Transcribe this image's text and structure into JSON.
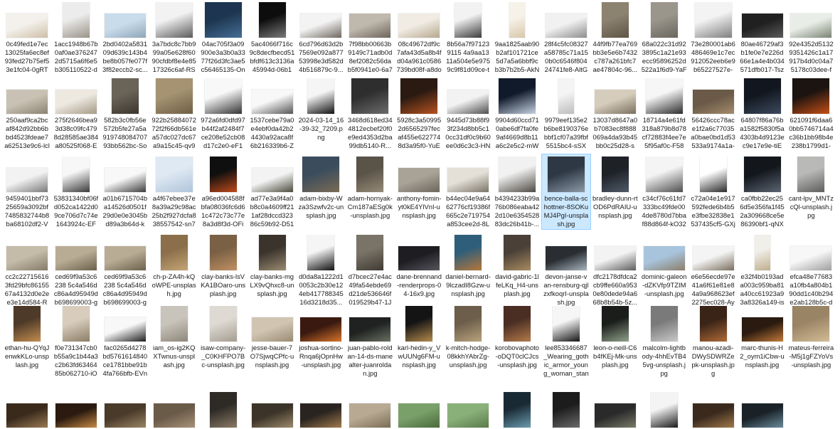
{
  "view": {
    "title": "",
    "columns": 17
  },
  "files": [
    {
      "name": "0c49fed1e7ec13025fa6ec8ef93fed27b75ef53e1fc04-0gRTB...",
      "thumb": {
        "bg": "#f4f1ec",
        "fg": "#cdbfa8",
        "shape": "landscape"
      }
    },
    {
      "name": "1acc1948b67b0af0ae3762472d5715a6f6e5b305110522-dMB...",
      "thumb": {
        "bg": "#ececec",
        "fg": "#9a9389",
        "shape": "portrait"
      }
    },
    {
      "name": "2bd0402a583109d639c143b4be8b057fe077f3f82eccb2-sc...",
      "thumb": {
        "bg": "#c9dcec",
        "fg": "#8fa6b8",
        "shape": "landscape"
      }
    },
    {
      "name": "3a7bdc8c7bb999a05e628f6090cfdbf8e4e8517326c6af-RSf...",
      "thumb": {
        "bg": "#f2f2f2",
        "fg": "#5b5b5b",
        "shape": "square"
      }
    },
    {
      "name": "04ac705f3a09900e3a3b0a3377f26d3fc3ae5c56465135-OnoT...",
      "thumb": {
        "bg": "#1d3550",
        "fg": "#456f96",
        "shape": "square"
      }
    },
    {
      "name": "5ac4066f716c9c8decfbecd51bfdf613c3136a45994d-06b1b...",
      "thumb": {
        "bg": "#0d0d0d",
        "fg": "#7a7a7a",
        "shape": "portrait"
      }
    },
    {
      "name": "6cd796d63d2b7569e092a87753998e3d582d4b516879c-9...",
      "thumb": {
        "bg": "#f3f3f3",
        "fg": "#6e675d",
        "shape": "landscape"
      }
    },
    {
      "name": "7f98bb00663b9149c71adb0d8ef2082c56dab5f0941e0-6a76...",
      "thumb": {
        "bg": "#bfb8ad",
        "fg": "#6d655b",
        "shape": "landscape"
      }
    },
    {
      "name": "08c49672df9c7afa43d5a8b4fd04a961c0586739bd08f-a8do1...",
      "thumb": {
        "bg": "#f0ece4",
        "fg": "#b7a88f",
        "shape": "landscape"
      }
    },
    {
      "name": "8b56a7f971239115 4a9aa1311a504e5e9759c9f81d09ce-taYP...",
      "thumb": {
        "bg": "#f2f2f2",
        "fg": "#3b3b3b",
        "shape": "portrait"
      }
    },
    {
      "name": "9aa1825aab90b2af101721ce5d7a5a6bbf9cb3b7b2b5-AkNr...",
      "thumb": {
        "bg": "#f6f2ea",
        "fg": "#d9c8aa",
        "shape": "tall"
      }
    },
    {
      "name": "28f4c5fc08327a58785c71a150b0c6546f80424741fe8-AltGo...",
      "thumb": {
        "bg": "#f1f1f1",
        "fg": "#8d8d8d",
        "shape": "landscape"
      }
    },
    {
      "name": "44f9fb77ea769bb3e5e6b7432c787a261bfc7ae47804c-96...",
      "thumb": {
        "bg": "#8c8270",
        "fg": "#5d5547",
        "shape": "portrait"
      }
    },
    {
      "name": "68a022c31d923895c1a21e93ecc95896252d522a1f6d9-YaF9...",
      "thumb": {
        "bg": "#9b968c",
        "fg": "#6a665e",
        "shape": "portrait"
      }
    },
    {
      "name": "73e280001ab6486469e1c7ec912052eeb6e9b65227527e-Q...",
      "thumb": {
        "bg": "#f3f3f3",
        "fg": "#7f7f7f",
        "shape": "square"
      }
    },
    {
      "name": "80ae46729af3b1fe0e7e226d66e1a4e4b034571dfb017-Tszy...",
      "thumb": {
        "bg": "#202020",
        "fg": "#5a5a5a",
        "shape": "landscape"
      }
    },
    {
      "name": "92e4352d51329351426c1a17917b4d0c04a75178c03dee-f6...",
      "thumb": {
        "bg": "#e9ede7",
        "fg": "#7b8474",
        "shape": "landscape"
      }
    },
    {
      "name": "250aaf9ca2bcaf842d92bb6bbd4523fdeae7a62513e9c6-lclzfj...",
      "thumb": {
        "bg": "#c9c2b4",
        "fg": "#8b8272",
        "shape": "landscape"
      }
    },
    {
      "name": "275f2646bea93d38c09fc4798d28585ae384a80525f068-Egw...",
      "thumb": {
        "bg": "#ede9e1",
        "fg": "#a69a86",
        "shape": "landscape"
      }
    },
    {
      "name": "582b3c0fb56e572b5fe27a5a91974808470793bb562bc-Soa...",
      "thumb": {
        "bg": "#6a6358",
        "fg": "#3c372f",
        "shape": "portrait"
      }
    },
    {
      "name": "922b25884072 72f2f66db561ea57dc027dc67a9a15c45-qv95...",
      "thumb": {
        "bg": "#a59372",
        "fg": "#6e5f45",
        "shape": "square"
      }
    },
    {
      "name": "972a6fd0dfd97b44f2af2484f7ce208e52cb08d17c2e0-eF1B...",
      "thumb": {
        "bg": "#f8f8f8",
        "fg": "#333333",
        "shape": "square"
      }
    },
    {
      "name": "1537cebe79a0e4ebf0da42b24430a92aca8f6b216339b6-Znh...",
      "thumb": {
        "bg": "#f8f8f8",
        "fg": "#555555",
        "shape": "landscape"
      }
    },
    {
      "name": "2024-03-14_16-39-32_7209.png",
      "thumb": {
        "bg": "#f5f5f5",
        "fg": "#111111",
        "shape": "portrait"
      }
    },
    {
      "name": "3468d618ed344812ecbef20f0e9ed4353d2ba99db5140-R...",
      "thumb": {
        "bg": "#2e2e2e",
        "fg": "#6b6b6b",
        "shape": "square"
      }
    },
    {
      "name": "5928c3a509952d6565297fecaf455e6227748d3a95f0-YuEw...",
      "thumb": {
        "bg": "#2a1a12",
        "fg": "#b6521f",
        "shape": "square"
      }
    },
    {
      "name": "9445d73b88f93f234d8bb5c10cc31df0c9b60ee0d6c3c3-HNx...",
      "thumb": {
        "bg": "#f2f2f2",
        "fg": "#4e4e4e",
        "shape": "landscape"
      }
    },
    {
      "name": "9904d60ccd710abe6df7fa0fe9af4669d8b11a6c2e5c2-mW8...",
      "thumb": {
        "bg": "#101a2a",
        "fg": "#c6d2e2",
        "shape": "square"
      }
    },
    {
      "name": "9979eef135e2b6be8190376ebbf1cf07a39fbf5515bc4-sSXH...",
      "thumb": {
        "bg": "#f4f4f4",
        "fg": "#bdbdbd",
        "shape": "tall"
      }
    },
    {
      "name": "13037d8647a0b7083ec8f888069a4da93b45bb0c25d28-s2...",
      "thumb": {
        "bg": "#d6ccbb",
        "fg": "#7b7060",
        "shape": "landscape"
      }
    },
    {
      "name": "18714a4e61fd318a879b8d78cf72883f4ee7e5f95af0c-F58m...",
      "thumb": {
        "bg": "#f6f6f6",
        "fg": "#2c2c2c",
        "shape": "square"
      }
    },
    {
      "name": "56426ccc78ace1f2a6c77035a0bae0bd1d53533a9174a1a-nL...",
      "thumb": {
        "bg": "#6a5a47",
        "fg": "#a48b6b",
        "shape": "landscape"
      }
    },
    {
      "name": "64807f86a76ba1582f5830f5a4303b4d9123ec9e17e9e-tiEo...",
      "thumb": {
        "bg": "#12171f",
        "fg": "#3c4a5e",
        "shape": "square"
      }
    },
    {
      "name": "621091f6daa60bb5746714a4c36b1bb98b4e238b1799d1-D...",
      "thumb": {
        "bg": "#1c1410",
        "fg": "#c44e16",
        "shape": "square"
      }
    },
    {
      "name": "9459401bbf7325659a3092bf7485832744b8ba68102df2-VPz...",
      "thumb": {
        "bg": "#f2f2f2",
        "fg": "#7a7a7a",
        "shape": "landscape"
      }
    },
    {
      "name": "53831340bf06fd052ca1422d09ce706d7c74e1643924c-EF1...",
      "thumb": {
        "bg": "#f7f7f7",
        "fg": "#3a3a3a",
        "shape": "portrait"
      }
    },
    {
      "name": "a01b6715704ba14526d0501f29d0e0e3045bd89a3b64d-kH...",
      "thumb": {
        "bg": "#f8f8f8",
        "fg": "#3d3d3d",
        "shape": "landscape"
      }
    },
    {
      "name": "a4f67ebee37e8a39a29c98ac25b2f927dcfa838557542-sn74...",
      "thumb": {
        "bg": "#dfe9f3",
        "fg": "#b0c4da",
        "shape": "square"
      }
    },
    {
      "name": "a96ed004588fbfa08036fc6d61c472c73c77e8a3d8f3d-OFimL...",
      "thumb": {
        "bg": "#0f0f0f",
        "fg": "#c04a1a",
        "shape": "portrait"
      }
    },
    {
      "name": "ad77e3a9f4a0b8c0a4609ff211af28dccd32386c59b92-D51Bn...",
      "thumb": {
        "bg": "#f3f3f3",
        "fg": "#4b4b3e",
        "shape": "landscape"
      }
    },
    {
      "name": "adam-bixby-Wza3Szwfv2c-unsplash.jpg",
      "thumb": {
        "bg": "#3b4d5d",
        "fg": "#7a6a55",
        "shape": "square"
      }
    },
    {
      "name": "adam-hornyak-Cm187aESg0k-unsplash.jpg",
      "thumb": {
        "bg": "#5a5348",
        "fg": "#958a77",
        "shape": "portrait"
      }
    },
    {
      "name": "anthony-fomin-yt0kE4YlVnI-unsplash.jpg",
      "thumb": {
        "bg": "#a9a297",
        "fg": "#6c665c",
        "shape": "landscape"
      }
    },
    {
      "name": "b44ec04e9a6462776cf19386f665c2e719754a853cee2d-8Ler...",
      "thumb": {
        "bg": "#e4e0d8",
        "fg": "#7b7568",
        "shape": "landscape"
      }
    },
    {
      "name": "b4394233b99a76b086eaba422d10e6354528 83dc26b41b-...",
      "thumb": {
        "bg": "#f1f1f1",
        "fg": "#4f4b45",
        "shape": "square"
      }
    },
    {
      "name": "bence-balla-schottner-8SOKuMJ4PgI-unsplash.jpg",
      "thumb": {
        "bg": "#2e3845",
        "fg": "#8d99a8",
        "shape": "square"
      }
    },
    {
      "name": "bradley-dunn-rtOD6PdRAIU-unsplash.jpg",
      "thumb": {
        "bg": "#1e2126",
        "fg": "#4e5a68",
        "shape": "portrait"
      }
    },
    {
      "name": "c34cf76c61fd7333bc49fde004de8780d7bbaf88d864f-kO32nS...",
      "thumb": {
        "bg": "#f4f4f4",
        "fg": "#4f4f4f",
        "shape": "square"
      }
    },
    {
      "name": "c72a04e1e917592fede6b4b5e3fbe32838e1537435cf5-GXjKx...",
      "thumb": {
        "bg": "#ffffff",
        "fg": "#2b2b2b",
        "shape": "portrait"
      }
    },
    {
      "name": "ca0fbb22ec256d5e356fa1f452a309668ce5e86390bf1-qNXL...",
      "thumb": {
        "bg": "#13171c",
        "fg": "#5a6472",
        "shape": "square"
      }
    },
    {
      "name": "cant-lpv_MNTzcQl-unsplash.jpg",
      "thumb": {
        "bg": "#b9b9b7",
        "fg": "#5e5e5c",
        "shape": "portrait"
      }
    },
    {
      "name": "cc2c227156163fd29bfc8615567a4132d0e2ee3e14d584-Rc...",
      "thumb": {
        "bg": "#c4bba9",
        "fg": "#857b68",
        "shape": "landscape"
      }
    },
    {
      "name": "ced69f9a53c6238 5c4a546dc86a4d95949db698699003-gZ6...",
      "thumb": {
        "bg": "#b9ac95",
        "fg": "#6d604c",
        "shape": "landscape"
      }
    },
    {
      "name": "ced69f9a53c6238 5c4a546dc86a4d95949db698699003-gZ6...",
      "thumb": {
        "bg": "#b9ac95",
        "fg": "#6d604c",
        "shape": "landscape"
      }
    },
    {
      "name": "ch-p-ZA4h-kQoWPE-unsplash.jpg",
      "thumb": {
        "bg": "#8a6f4a",
        "fg": "#c4a574",
        "shape": "portrait"
      }
    },
    {
      "name": "clay-banks-lsVKA1BOaro-unsplash.jpg",
      "thumb": {
        "bg": "#7a6045",
        "fg": "#c09062",
        "shape": "portrait"
      }
    },
    {
      "name": "clay-banks-mgLX9vQhxc8-unsplash.jpg",
      "thumb": {
        "bg": "#3a342c",
        "fg": "#9a8a70",
        "shape": "portrait"
      }
    },
    {
      "name": "d0da8a1222d10053c2b30e12 4eb417788345 16d3218d35...",
      "thumb": {
        "bg": "#f5f5f5",
        "fg": "#111111",
        "shape": "portrait"
      }
    },
    {
      "name": "d7bcec27e4ac49fa54ebde69d21de536646f019529b47-1Jg9...",
      "thumb": {
        "bg": "#7a7468",
        "fg": "#3f3b34",
        "shape": "portrait"
      }
    },
    {
      "name": "dane-brennand-renderprops-04-16x9.jpg",
      "thumb": {
        "bg": "#1e1e22",
        "fg": "#55555d",
        "shape": "landscape"
      }
    },
    {
      "name": "daniel-bernard-9lczadI8Gzw-unsplash.jpg",
      "thumb": {
        "bg": "#2f5e7a",
        "fg": "#b5763a",
        "shape": "portrait"
      }
    },
    {
      "name": "david-gabric-1lfeLKq_H4-unsplash.jpg",
      "thumb": {
        "bg": "#4a4038",
        "fg": "#a88b5e",
        "shape": "portrait"
      }
    },
    {
      "name": "devon-janse-van-rensburg-qjlzxfkoqrI-unsplash.jpg",
      "thumb": {
        "bg": "#2a2e33",
        "fg": "#a7b3bd",
        "shape": "landscape"
      }
    },
    {
      "name": "dfc2178dfdca2cb9ffe660a9530e80dede94a668b8b54b-5z...",
      "thumb": {
        "bg": "#f3f3f3",
        "fg": "#5d5d5d",
        "shape": "landscape"
      }
    },
    {
      "name": "dominic-galeon-dZKVfp9TZIM-unsplash.jpg",
      "thumb": {
        "bg": "#a8c4dc",
        "fg": "#8b7e6a",
        "shape": "landscape"
      }
    },
    {
      "name": "e6e56ecde97e41a6f61e81e84a9a968623ef2275ec028-AyG...",
      "thumb": {
        "bg": "#f4f4f4",
        "fg": "#7a6e5d",
        "shape": "landscape"
      }
    },
    {
      "name": "e32f4b0193ada003c959ba81a40cc61923a93a8326a149-ishp...",
      "thumb": {
        "bg": "#f1efe9",
        "fg": "#bfae8c",
        "shape": "tall"
      }
    },
    {
      "name": "efca48e77683a10fb4a804b190dd1c40b294e2ab128b5c-dX...",
      "thumb": {
        "bg": "#f7f7f7",
        "fg": "#9f9f9f",
        "shape": "landscape"
      }
    },
    {
      "name": "ethan-hu-QYqJenwkKLo-unsplash.jpg",
      "thumb": {
        "bg": "#4e3a28",
        "fg": "#c28c4f",
        "shape": "portrait"
      }
    },
    {
      "name": "f0e731347cb0b55a9c1b44a3c2b63fd6346485b062710-iOGI1...",
      "thumb": {
        "bg": "#d8cdbd",
        "fg": "#8c7e66",
        "shape": "portrait"
      }
    },
    {
      "name": "fac0265d4278bd5761614840ce1781bbe91b4fa766bfb-EVnl...",
      "thumb": {
        "bg": "#f8f8f8",
        "fg": "#1f1f1f",
        "shape": "landscape"
      }
    },
    {
      "name": "iam_os-ig2KQXTwnus-unsplash.jpg",
      "thumb": {
        "bg": "#c9c4bb",
        "fg": "#8e877b",
        "shape": "portrait"
      }
    },
    {
      "name": "isaw-company-_C0KHFPO7Bc-unsplash.jpg",
      "thumb": {
        "bg": "#dedad3",
        "fg": "#a49d90",
        "shape": "portrait"
      }
    },
    {
      "name": "jesse-bauer-7O7SjwqCPfc-unsplash.jpg",
      "thumb": {
        "bg": "#d1c5b2",
        "fg": "#9a8b73",
        "shape": "landscape"
      }
    },
    {
      "name": "joshua-sortino-Rnqa6jOpnHw-unsplash.jpg",
      "thumb": {
        "bg": "#3a1a10",
        "fg": "#d8742a",
        "shape": "landscape"
      }
    },
    {
      "name": "juan-pablo-roldan-14-ds-manealter-juanroldan.jpg",
      "thumb": {
        "bg": "#1f2220",
        "fg": "#6a7063",
        "shape": "landscape"
      }
    },
    {
      "name": "karl-hedin-y_VwUUNg6FM-unsplash.jpg",
      "thumb": {
        "bg": "#141414",
        "fg": "#b38a4c",
        "shape": "portrait"
      }
    },
    {
      "name": "k-mitch-hodge-08kkhYAbrZg-unsplash.jpg",
      "thumb": {
        "bg": "#6c5e4a",
        "fg": "#b9a27c",
        "shape": "portrait"
      }
    },
    {
      "name": "korobovaphoto-oDQT0clCJcs-unsplash.jpg",
      "thumb": {
        "bg": "#4a2e24",
        "fg": "#b47a4a",
        "shape": "portrait"
      }
    },
    {
      "name": "lee853346687_Wearing_gothic_armor_young_woman_standi...",
      "thumb": {
        "bg": "#f6f6f6",
        "fg": "#151515",
        "shape": "portrait"
      }
    },
    {
      "name": "leon-o-neill-C6b4fKEj-Mk-unsplash.jpg",
      "thumb": {
        "bg": "#1a1d1a",
        "fg": "#8fa08a",
        "shape": "portrait"
      }
    },
    {
      "name": "malcolm-lightbody-4hhEvTB45vg-unsplash.jpg",
      "thumb": {
        "bg": "#7a7a7a",
        "fg": "#c8c8c8",
        "shape": "portrait"
      }
    },
    {
      "name": "manou-azadi-DWySDWRZepk-unsplash.jpg",
      "thumb": {
        "bg": "#3a2418",
        "fg": "#b06a36",
        "shape": "portrait"
      }
    },
    {
      "name": "marc-thunis-H2_oym1iCbw-unsplash.jpg",
      "thumb": {
        "bg": "#2a1a10",
        "fg": "#c27a38",
        "shape": "landscape"
      }
    },
    {
      "name": "mateus-ferreira-M5j1gFZYoVs-unsplash.jpg",
      "thumb": {
        "bg": "#9a8466",
        "fg": "#d2bc94",
        "shape": "square"
      }
    },
    {
      "name": "",
      "thumb": {
        "bg": "#3a2a1c",
        "fg": "#9a7a52",
        "shape": "landscape"
      }
    },
    {
      "name": "",
      "thumb": {
        "bg": "#2a1a10",
        "fg": "#c88a44",
        "shape": "landscape"
      }
    },
    {
      "name": "",
      "thumb": {
        "bg": "#4a3a2a",
        "fg": "#9a8464",
        "shape": "landscape"
      }
    },
    {
      "name": "",
      "thumb": {
        "bg": "#6a5a48",
        "fg": "#a8937a",
        "shape": "landscape"
      }
    },
    {
      "name": "",
      "thumb": {
        "bg": "#2e2a26",
        "fg": "#8a7a66",
        "shape": "portrait"
      }
    },
    {
      "name": "",
      "thumb": {
        "bg": "#3c3428",
        "fg": "#9c8a6c",
        "shape": "landscape"
      }
    },
    {
      "name": "",
      "thumb": {
        "bg": "#2a2420",
        "fg": "#a07a4c",
        "shape": "landscape"
      }
    },
    {
      "name": "",
      "thumb": {
        "bg": "#b8aa92",
        "fg": "#7a6c56",
        "shape": "landscape"
      }
    },
    {
      "name": "",
      "thumb": {
        "bg": "#7aa06a",
        "fg": "#4a6a3a",
        "shape": "landscape"
      }
    },
    {
      "name": "",
      "thumb": {
        "bg": "#8ab07a",
        "fg": "#5a7a4a",
        "shape": "landscape"
      }
    },
    {
      "name": "",
      "thumb": {
        "bg": "#1a2a34",
        "fg": "#6a9aae",
        "shape": "portrait"
      }
    },
    {
      "name": "",
      "thumb": {
        "bg": "#1c1c1c",
        "fg": "#6a6a6a",
        "shape": "portrait"
      }
    },
    {
      "name": "",
      "thumb": {
        "bg": "#2a2a2a",
        "fg": "#7a7a6a",
        "shape": "landscape"
      }
    },
    {
      "name": "",
      "thumb": {
        "bg": "#f4f4f4",
        "fg": "#1a1a1a",
        "shape": "portrait"
      }
    },
    {
      "name": "",
      "thumb": {
        "bg": "#3a2a1e",
        "fg": "#a0784a",
        "shape": "landscape"
      }
    },
    {
      "name": "",
      "thumb": {
        "bg": "#1a2228",
        "fg": "#6a8a9a",
        "shape": "landscape"
      }
    }
  ],
  "selected_index": 45,
  "colors": {
    "selection_bg": "#cce8ff",
    "selection_border": "#99d1ff",
    "text": "#1a1a1a"
  }
}
